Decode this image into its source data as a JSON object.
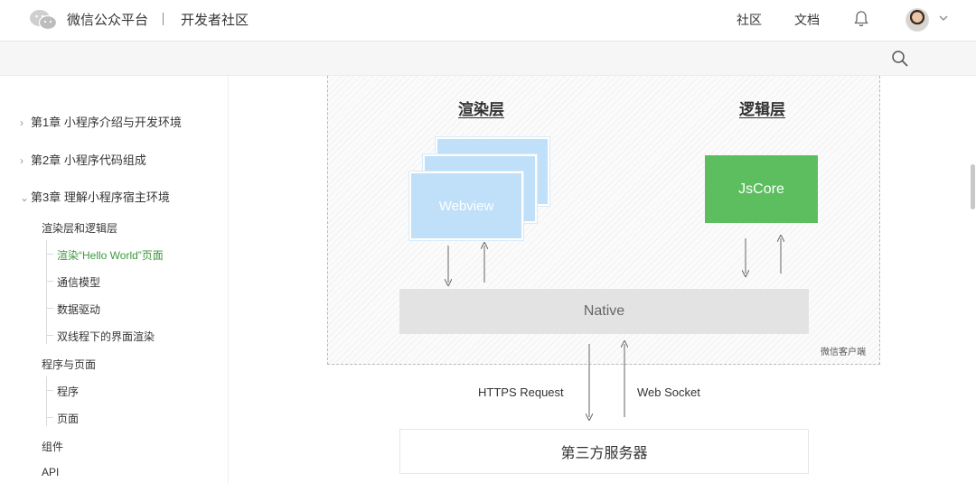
{
  "header": {
    "brand": "微信公众平台",
    "section": "开发者社区",
    "nav": [
      "社区",
      "文档"
    ]
  },
  "sidebar": {
    "chapters": [
      {
        "label": "第1章 小程序介绍与开发环境",
        "expanded": false
      },
      {
        "label": "第2章 小程序代码组成",
        "expanded": false
      },
      {
        "label": "第3章 理解小程序宿主环境",
        "expanded": true
      }
    ],
    "sections": [
      {
        "label": "渲染层和逻辑层",
        "items": [
          "渲染“Hello World”页面",
          "通信模型",
          "数据驱动",
          "双线程下的界面渲染"
        ]
      },
      {
        "label": "程序与页面",
        "items": [
          "程序",
          "页面"
        ]
      },
      {
        "label": "组件",
        "items": []
      },
      {
        "label": "API",
        "items": []
      }
    ],
    "active_item": "渲染“Hello World”页面"
  },
  "diagram": {
    "render_layer_title": "渲染层",
    "logic_layer_title": "逻辑层",
    "webview_label": "Webview",
    "jscore_label": "JsCore",
    "native_label": "Native",
    "client_label": "微信客户端",
    "https_label": "HTTPS Request",
    "websocket_label": "Web Socket",
    "server_label": "第三方服务器"
  },
  "colors": {
    "active_link": "#3c9a3c",
    "webview_fill": "#bfe0f8",
    "jscore_fill": "#5cbe5f",
    "native_fill": "#e3e3e3"
  },
  "icons": [
    "wechat-logo-icon",
    "bell-icon",
    "chevron-down-icon",
    "search-icon",
    "chevron-right-icon",
    "chevron-down-icon"
  ]
}
